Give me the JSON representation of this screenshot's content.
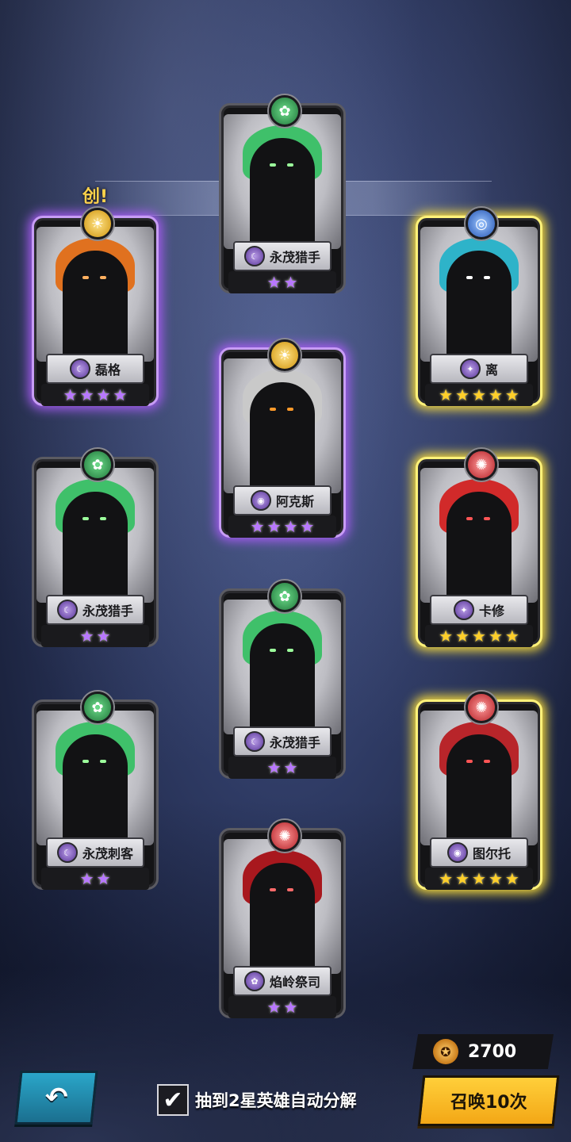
{
  "banner_fragment": "创!",
  "cards": [
    {
      "name": "永茂猎手",
      "stars": 2,
      "star_color": "purple",
      "element": "forest",
      "element_glyph": "✿",
      "class_glyph": "☾",
      "glow": "none",
      "hair": "#3fc06a",
      "eyes": "#9cff9c",
      "col": 1,
      "row": 0
    },
    {
      "name": "磊格",
      "stars": 4,
      "star_color": "purple",
      "element": "sun",
      "element_glyph": "☀",
      "class_glyph": "☾",
      "glow": "purple",
      "hair": "#e0711f",
      "eyes": "#ffb060",
      "col": 0,
      "row": 1
    },
    {
      "name": "离",
      "stars": 5,
      "star_color": "gold",
      "element": "water",
      "element_glyph": "◎",
      "class_glyph": "✦",
      "glow": "gold",
      "hair": "#2eb3c9",
      "eyes": "#ffffff",
      "col": 2,
      "row": 1
    },
    {
      "name": "阿克斯",
      "stars": 4,
      "star_color": "purple",
      "element": "sun",
      "element_glyph": "☀",
      "class_glyph": "◉",
      "glow": "purple",
      "hair": "#c9c9c9",
      "eyes": "#ff9a2a",
      "col": 1,
      "row": 2
    },
    {
      "name": "永茂猎手",
      "stars": 2,
      "star_color": "purple",
      "element": "forest",
      "element_glyph": "✿",
      "class_glyph": "☾",
      "glow": "none",
      "hair": "#3fc06a",
      "eyes": "#9cff9c",
      "col": 0,
      "row": 3
    },
    {
      "name": "卡修",
      "stars": 5,
      "star_color": "gold",
      "element": "fire",
      "element_glyph": "✺",
      "class_glyph": "✦",
      "glow": "gold",
      "hair": "#d12a2a",
      "eyes": "#ff5555",
      "col": 2,
      "row": 3
    },
    {
      "name": "永茂猎手",
      "stars": 2,
      "star_color": "purple",
      "element": "forest",
      "element_glyph": "✿",
      "class_glyph": "☾",
      "glow": "none",
      "hair": "#3fc06a",
      "eyes": "#9cff9c",
      "col": 1,
      "row": 4
    },
    {
      "name": "永茂刺客",
      "stars": 2,
      "star_color": "purple",
      "element": "forest",
      "element_glyph": "✿",
      "class_glyph": "☾",
      "glow": "none",
      "hair": "#3fc06a",
      "eyes": "#9cff9c",
      "col": 0,
      "row": 5
    },
    {
      "name": "图尔托",
      "stars": 5,
      "star_color": "gold",
      "element": "fire",
      "element_glyph": "✺",
      "class_glyph": "◉",
      "glow": "gold",
      "hair": "#b8252a",
      "eyes": "#ff5555",
      "col": 2,
      "row": 5
    },
    {
      "name": "焰岭祭司",
      "stars": 2,
      "star_color": "purple",
      "element": "fire",
      "element_glyph": "✺",
      "class_glyph": "✿",
      "glow": "none",
      "hair": "#a8181e",
      "eyes": "#ff6a6a",
      "col": 1,
      "row": 6
    }
  ],
  "footer": {
    "back_glyph": "↶",
    "auto_decompose_checked": true,
    "auto_decompose_label": "抽到2星英雄自动分解",
    "check_glyph": "✔",
    "cost_icon_glyph": "✪",
    "cost_value": "2700",
    "summon_label": "召唤10次"
  }
}
